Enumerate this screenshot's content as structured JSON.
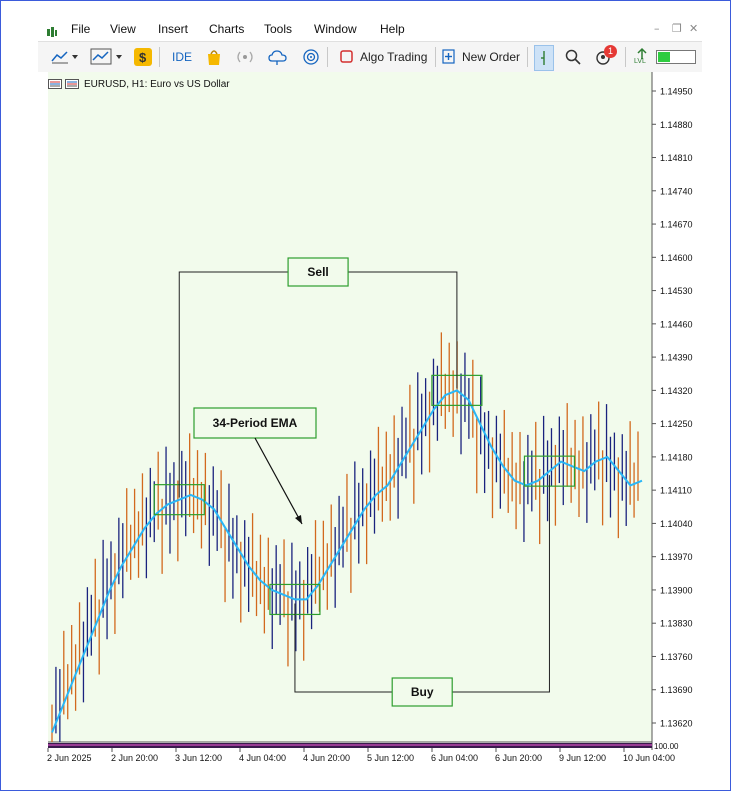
{
  "menu": {
    "items": [
      "File",
      "View",
      "Insert",
      "Charts",
      "Tools",
      "Window",
      "Help"
    ]
  },
  "toolbar": {
    "ide_label": "IDE",
    "algo_trading_label": "Algo Trading",
    "new_order_label": "New Order",
    "notification_count": "1",
    "lvl_label": "LVL"
  },
  "chart": {
    "title": "EURUSD, H1:  Euro vs US Dollar"
  },
  "chart_data": {
    "type": "candlestick",
    "symbol": "EURUSD",
    "timeframe": "H1",
    "ylim": [
      1.1358,
      1.1499
    ],
    "y_ticks": [
      "1.14950",
      "1.14880",
      "1.14810",
      "1.14740",
      "1.14670",
      "1.14600",
      "1.14530",
      "1.14460",
      "1.14390",
      "1.14320",
      "1.14250",
      "1.14180",
      "1.14110",
      "1.14040",
      "1.13970",
      "1.13900",
      "1.13830",
      "1.13760",
      "1.13690",
      "1.13620"
    ],
    "x_ticks": [
      "2 Jun 2025",
      "2 Jun 20:00",
      "3 Jun 12:00",
      "4 Jun 04:00",
      "4 Jun 20:00",
      "5 Jun 12:00",
      "6 Jun 04:00",
      "6 Jun 20:00",
      "9 Jun 12:00",
      "10 Jun 04:00"
    ],
    "bottom_label": "100.00",
    "series": [
      {
        "name": "34-Period EMA",
        "color": "#29b6f6",
        "values": [
          1.136,
          1.1366,
          1.1372,
          1.1378,
          1.1384,
          1.139,
          1.1395,
          1.1399,
          1.1403,
          1.1406,
          1.1408,
          1.1409,
          1.141,
          1.1409,
          1.1407,
          1.1403,
          1.1399,
          1.1395,
          1.1392,
          1.139,
          1.1389,
          1.1388,
          1.1388,
          1.1391,
          1.1395,
          1.1399,
          1.1403,
          1.1407,
          1.141,
          1.1412,
          1.1416,
          1.142,
          1.1424,
          1.1428,
          1.1431,
          1.1432,
          1.143,
          1.1425,
          1.142,
          1.1416,
          1.1413,
          1.1412,
          1.1413,
          1.1415,
          1.1417,
          1.1416,
          1.1415,
          1.1417,
          1.1418,
          1.1415,
          1.1412,
          1.1413
        ]
      }
    ],
    "annotations": [
      "Sell",
      "34-Period EMA",
      "Buy"
    ],
    "background": "#f2fbec",
    "bull_color": "#1a237e",
    "bear_color": "#d2691e"
  }
}
